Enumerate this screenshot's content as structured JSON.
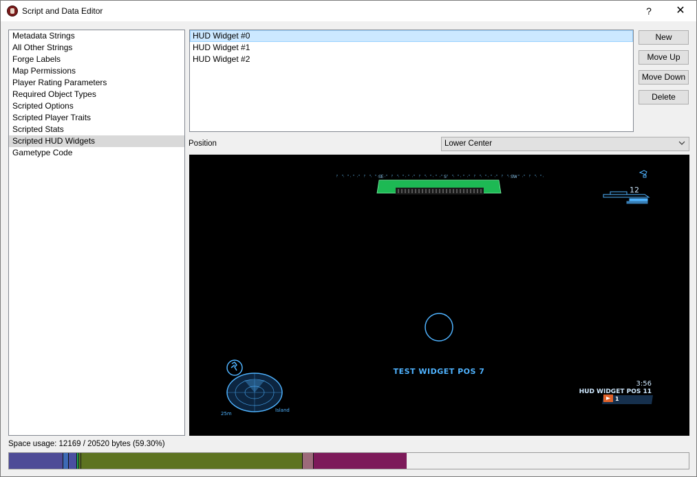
{
  "window": {
    "title": "Script and Data Editor",
    "help_label": "?",
    "close_label": "✕"
  },
  "sidebar": {
    "items": [
      {
        "label": "Metadata Strings"
      },
      {
        "label": "All Other Strings"
      },
      {
        "label": "Forge Labels"
      },
      {
        "label": "Map Permissions"
      },
      {
        "label": "Player Rating Parameters"
      },
      {
        "label": "Required Object Types"
      },
      {
        "label": "Scripted Options"
      },
      {
        "label": "Scripted Player Traits"
      },
      {
        "label": "Scripted Stats"
      },
      {
        "label": "Scripted HUD Widgets",
        "selected": true
      },
      {
        "label": "Gametype Code"
      }
    ]
  },
  "widgets": {
    "items": [
      {
        "label": "HUD Widget #0",
        "selected": true
      },
      {
        "label": "HUD Widget #1"
      },
      {
        "label": "HUD Widget #2"
      }
    ]
  },
  "buttons": {
    "new": "New",
    "move_up": "Move Up",
    "move_down": "Move Down",
    "delete": "Delete"
  },
  "position": {
    "label": "Position",
    "value": "Lower Center"
  },
  "preview": {
    "center_widget_text": "TEST WIDGET POS 7",
    "right_widget_text": "HUD WIDGET POS 11",
    "timer": "3:56",
    "score": "1",
    "ammo": "12",
    "radar_range": "25m",
    "location": "Island",
    "compass_letters": [
      "SE",
      "S",
      "SW"
    ],
    "hud_color": "#4fb3ff",
    "shield_color": "#1db954"
  },
  "usage": {
    "label": "Space usage: 12169 / 20520 bytes (59.30%)",
    "used_fraction": 0.593,
    "segments": [
      {
        "color": "#4e4b97",
        "fraction": 0.079
      },
      {
        "color": "#3d6ab5",
        "fraction": 0.008
      },
      {
        "color": "#4a4fa0",
        "fraction": 0.012
      },
      {
        "color": "#1fa84a",
        "fraction": 0.003
      },
      {
        "color": "#6b7c2a",
        "fraction": 0.003
      },
      {
        "color": "#5d7320",
        "fraction": 0.326
      },
      {
        "color": "#9c6a7a",
        "fraction": 0.016
      },
      {
        "color": "#7d1a5a",
        "fraction": 0.138
      }
    ]
  }
}
